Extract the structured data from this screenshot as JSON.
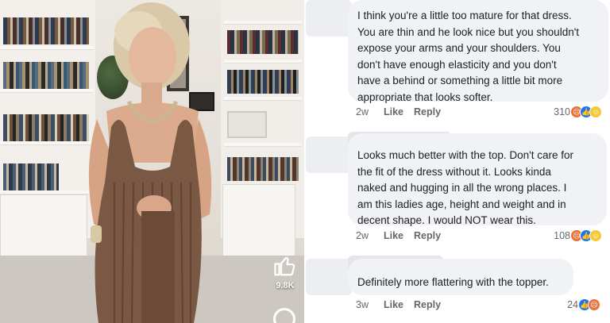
{
  "video": {
    "like_count": "9.8K",
    "icons": [
      "thumbs-up-icon",
      "comment-icon"
    ]
  },
  "comments": [
    {
      "text": "I think you're a little too mature for that dress.\nYou are thin and he look nice but you shouldn't\nexpose your arms and your shoulders. You\ndon't have enough elasticity and you don't\nhave a behind or something a little bit more\nappropriate that looks softer.",
      "time": "2w",
      "like_label": "Like",
      "reply_label": "Reply",
      "reaction_count": "310",
      "reactions": [
        "angry",
        "like",
        "haha"
      ]
    },
    {
      "text": "Looks much better with the top. Don't care for\nthe fit of the dress without it. Looks kinda\nnaked and hugging in all the wrong places. I\nam this ladies age, height and weight and in\ndecent shape. I would NOT wear this.",
      "time": "2w",
      "like_label": "Like",
      "reply_label": "Reply",
      "reaction_count": "108",
      "reactions": [
        "angry",
        "like",
        "haha"
      ]
    },
    {
      "text": "Definitely more flattering with the topper.",
      "time": "3w",
      "like_label": "Like",
      "reply_label": "Reply",
      "reaction_count": "24",
      "reactions": [
        "like",
        "angry"
      ]
    }
  ],
  "colors": {
    "bubble": "#f0f2f5",
    "meta_text": "#65676b",
    "like_blue": "#1877f2",
    "angry_orange": "#e8743b",
    "haha_yellow": "#f7c83a",
    "dress": "#7a5843"
  }
}
